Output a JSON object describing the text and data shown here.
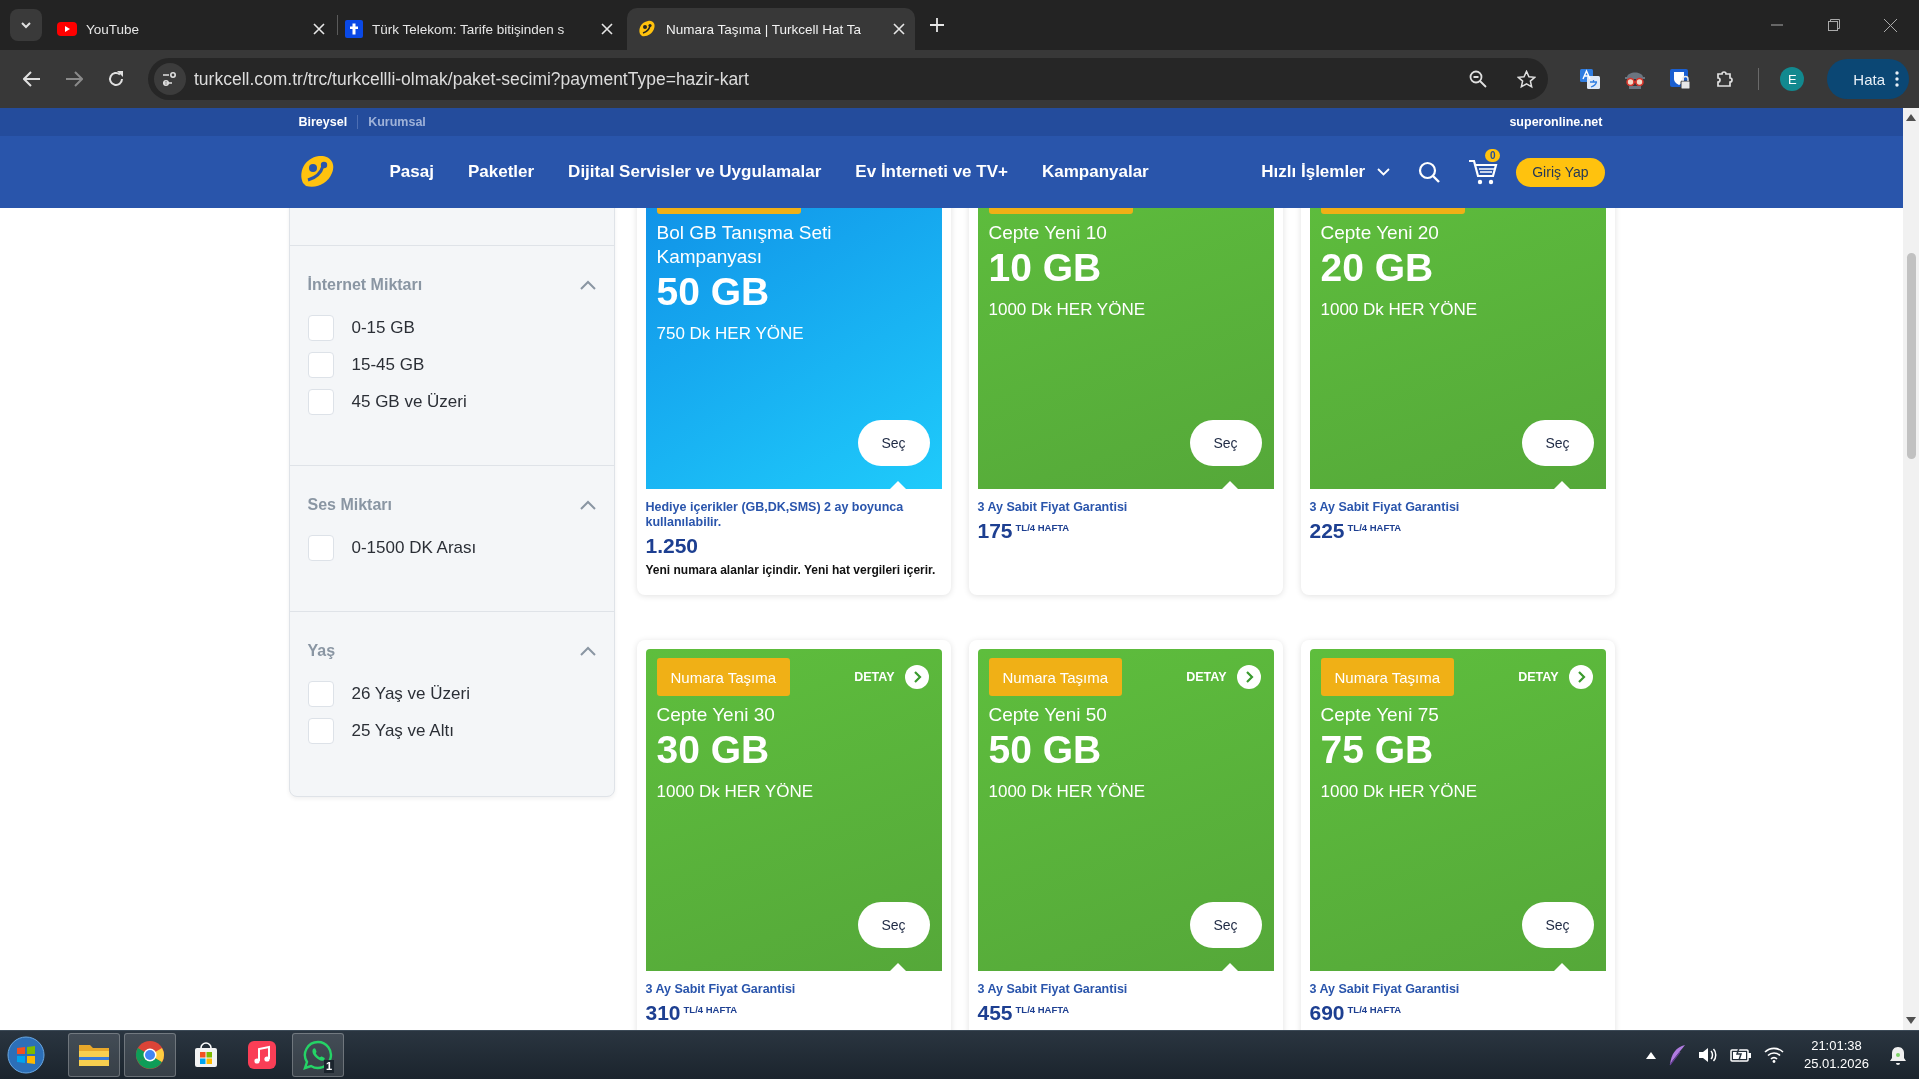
{
  "browser": {
    "tabs": [
      {
        "kind": "youtube",
        "title": "YouTube",
        "selected": false
      },
      {
        "kind": "telekom",
        "title": "Türk Telekom: Tarife bitişinden s",
        "selected": false
      },
      {
        "kind": "turkcell",
        "title": "Numara Taşıma | Turkcell Hat Ta",
        "selected": true
      }
    ],
    "url": "turkcell.com.tr/trc/turkcellli-olmak/paket-secimi?paymentType=hazir-kart",
    "profile_initial": "E",
    "menu_button": "Hata"
  },
  "site": {
    "segments": [
      {
        "label": "Bireysel",
        "selected": true
      },
      {
        "label": "Kurumsal",
        "selected": false
      }
    ],
    "partner_link": "superonline.net",
    "nav": [
      "Pasaj",
      "Paketler",
      "Dijital Servisler ve Uygulamalar",
      "Ev İnterneti ve TV+",
      "Kampanyalar"
    ],
    "quick_actions": "Hızlı İşlemler",
    "cart_count": "0",
    "login": "Giriş Yap"
  },
  "filters": [
    {
      "title": "İnternet Miktarı",
      "expanded": true,
      "options": [
        {
          "label": "0-15 GB",
          "checked": false
        },
        {
          "label": "15-45 GB",
          "checked": false
        },
        {
          "label": "45 GB ve Üzeri",
          "checked": false
        }
      ]
    },
    {
      "title": "Ses Miktarı",
      "expanded": true,
      "options": [
        {
          "label": "0-1500 DK Arası",
          "checked": false
        }
      ]
    },
    {
      "title": "Yaş",
      "expanded": true,
      "options": [
        {
          "label": "26 Yaş ve Üzeri",
          "checked": false
        },
        {
          "label": "25 Yaş ve Altı",
          "checked": false
        }
      ]
    }
  ],
  "packages": [
    {
      "kind": "campaign",
      "top_clipped": true,
      "name": "Bol GB Tanışma Seti Kampanyası",
      "data": "50 GB",
      "minutes": "750 Dk HER YÖNE",
      "select": "Seç",
      "note": "Hediye içerikler (GB,DK,SMS) 2 ay boyunca kullanılabilir.",
      "price": "1.250",
      "extra": "Yeni numara alanlar içindir. Yeni hat vergileri içerir."
    },
    {
      "kind": "plan",
      "top_clipped": true,
      "name": "Cepte Yeni 10",
      "data": "10 GB",
      "minutes": "1000 Dk HER YÖNE",
      "select": "Seç",
      "note": "3 Ay Sabit Fiyat Garantisi",
      "price": "175",
      "price_unit": "TL/4 HAFTA"
    },
    {
      "kind": "plan",
      "top_clipped": true,
      "name": "Cepte Yeni 20",
      "data": "20 GB",
      "minutes": "1000 Dk HER YÖNE",
      "select": "Seç",
      "note": "3 Ay Sabit Fiyat Garantisi",
      "price": "225",
      "price_unit": "TL/4 HAFTA"
    },
    {
      "kind": "plan",
      "top_clipped": false,
      "badge": "Numara Taşıma",
      "detail": "DETAY",
      "name": "Cepte Yeni 30",
      "data": "30 GB",
      "minutes": "1000 Dk HER YÖNE",
      "select": "Seç",
      "note": "3 Ay Sabit Fiyat Garantisi",
      "price": "310",
      "price_unit": "TL/4 HAFTA"
    },
    {
      "kind": "plan",
      "top_clipped": false,
      "badge": "Numara Taşıma",
      "detail": "DETAY",
      "name": "Cepte Yeni 50",
      "data": "50 GB",
      "minutes": "1000 Dk HER YÖNE",
      "select": "Seç",
      "note": "3 Ay Sabit Fiyat Garantisi",
      "price": "455",
      "price_unit": "TL/4 HAFTA"
    },
    {
      "kind": "plan",
      "top_clipped": false,
      "badge": "Numara Taşıma",
      "detail": "DETAY",
      "name": "Cepte Yeni 75",
      "data": "75 GB",
      "minutes": "1000 Dk HER YÖNE",
      "select": "Seç",
      "note": "3 Ay Sabit Fiyat Garantisi",
      "price": "690",
      "price_unit": "TL/4 HAFTA"
    }
  ],
  "taskbar": {
    "apps": [
      {
        "kind": "explorer",
        "open": true
      },
      {
        "kind": "chrome",
        "open": true
      },
      {
        "kind": "store",
        "open": false
      },
      {
        "kind": "music",
        "open": false
      },
      {
        "kind": "whatsapp",
        "open": true,
        "badge": "1"
      }
    ],
    "time": "21:01:38",
    "date": "25.01.2026"
  }
}
